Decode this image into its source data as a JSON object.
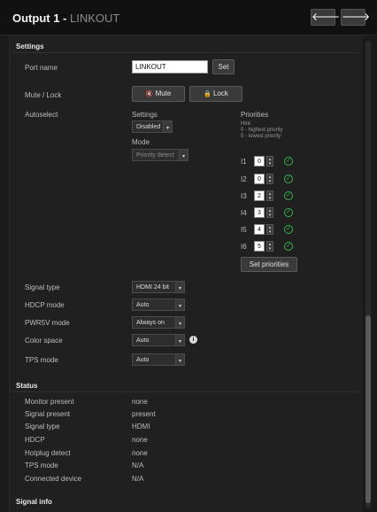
{
  "header": {
    "title": "Output 1 - ",
    "subtitle": "LINKOUT",
    "prev_icon": "arrow-left-icon",
    "next_icon": "arrow-right-icon",
    "prev_glyph": "🡐",
    "next_glyph": "🡒"
  },
  "settings": {
    "title": "Settings",
    "port_name": {
      "label": "Port name",
      "value": "LINKOUT",
      "set_label": "Set"
    },
    "mute_lock": {
      "label": "Mute / Lock",
      "mute_label": "Mute",
      "lock_label": "Lock"
    },
    "autoselect": {
      "label": "Autoselect",
      "settings_label": "Settings",
      "settings_value": "Disabled",
      "mode_label": "Mode",
      "mode_value": "Priority detect",
      "priorities_label": "Priorities",
      "hint_1": "Hint:",
      "hint_2": "0 - highest priority",
      "hint_3": "5 - lowest priority",
      "priorities": [
        {
          "label": "I1",
          "value": "0"
        },
        {
          "label": "I2",
          "value": "0"
        },
        {
          "label": "I3",
          "value": "2"
        },
        {
          "label": "I4",
          "value": "3"
        },
        {
          "label": "I5",
          "value": "4"
        },
        {
          "label": "I6",
          "value": "5"
        }
      ],
      "set_priorities_label": "Set priorities"
    },
    "signal_type": {
      "label": "Signal type",
      "value": "HDMI 24 bit"
    },
    "hdcp_mode": {
      "label": "HDCP mode",
      "value": "Auto"
    },
    "pwr5v_mode": {
      "label": "PWR5V mode",
      "value": "Always on"
    },
    "color_space": {
      "label": "Color space",
      "value": "Auto"
    },
    "tps_mode": {
      "label": "TPS mode",
      "value": "Auto"
    }
  },
  "status": {
    "title": "Status",
    "rows": [
      {
        "label": "Monitor present",
        "value": "none"
      },
      {
        "label": "Signal present",
        "value": "present"
      },
      {
        "label": "Signal type",
        "value": "HDMI"
      },
      {
        "label": "HDCP",
        "value": "none"
      },
      {
        "label": "Hotplug detect",
        "value": "none"
      },
      {
        "label": "TPS mode",
        "value": "N/A"
      },
      {
        "label": "Connected device",
        "value": "N/A"
      }
    ]
  },
  "signal_info": {
    "title": "Signal info"
  },
  "colors": {
    "background": "#1a1a1a",
    "panel": "#202020",
    "check": "#37b24d"
  }
}
